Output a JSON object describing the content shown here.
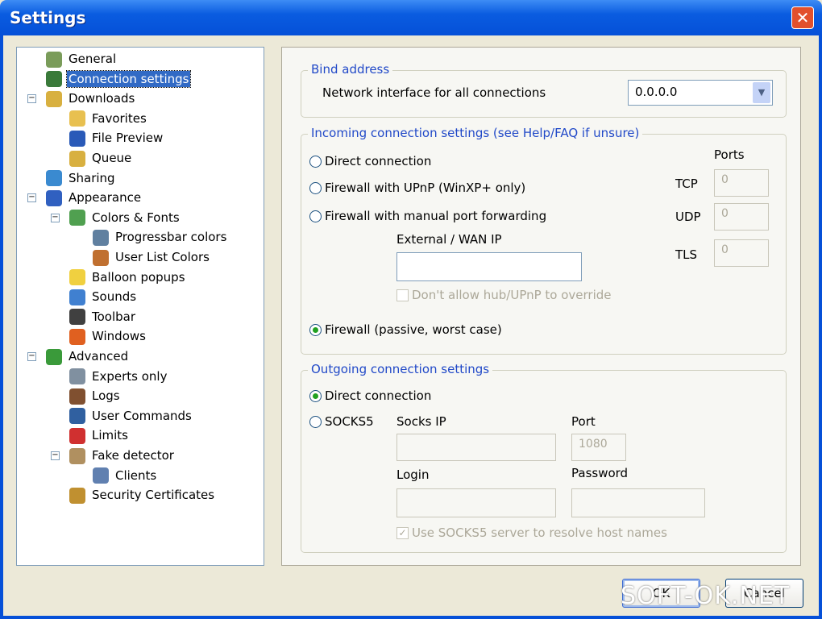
{
  "window": {
    "title": "Settings",
    "close_label": "✕"
  },
  "tree": [
    {
      "label": "General",
      "level": 0,
      "color": "#7a9c5a"
    },
    {
      "label": "Connection settings",
      "level": 0,
      "color": "#3a7a3a",
      "selected": true
    },
    {
      "label": "Downloads",
      "level": 0,
      "color": "#d8b040",
      "expander": "−"
    },
    {
      "label": "Favorites",
      "level": 1,
      "color": "#e8c050"
    },
    {
      "label": "File Preview",
      "level": 1,
      "color": "#2a5ab8"
    },
    {
      "label": "Queue",
      "level": 1,
      "color": "#d8b040"
    },
    {
      "label": "Sharing",
      "level": 0,
      "color": "#3a8ad0"
    },
    {
      "label": "Appearance",
      "level": 0,
      "color": "#3060c0",
      "expander": "−"
    },
    {
      "label": "Colors & Fonts",
      "level": 1,
      "color": "#50a050",
      "expander": "−"
    },
    {
      "label": "Progressbar colors",
      "level": 2,
      "color": "#6080a0"
    },
    {
      "label": "User List Colors",
      "level": 2,
      "color": "#c07030"
    },
    {
      "label": "Balloon popups",
      "level": 1,
      "color": "#f0d040"
    },
    {
      "label": "Sounds",
      "level": 1,
      "color": "#4080d0"
    },
    {
      "label": "Toolbar",
      "level": 1,
      "color": "#404040"
    },
    {
      "label": "Windows",
      "level": 1,
      "color": "#e06020"
    },
    {
      "label": "Advanced",
      "level": 0,
      "color": "#3a9a3a",
      "expander": "−"
    },
    {
      "label": "Experts only",
      "level": 1,
      "color": "#8090a0"
    },
    {
      "label": "Logs",
      "level": 1,
      "color": "#805030"
    },
    {
      "label": "User Commands",
      "level": 1,
      "color": "#3060a0"
    },
    {
      "label": "Limits",
      "level": 1,
      "color": "#d03030"
    },
    {
      "label": "Fake detector",
      "level": 1,
      "color": "#b09060",
      "expander": "−"
    },
    {
      "label": "Clients",
      "level": 2,
      "color": "#6080b0"
    },
    {
      "label": "Security Certificates",
      "level": 1,
      "color": "#c09030"
    }
  ],
  "bind": {
    "legend": "Bind address",
    "label": "Network interface for all connections",
    "value": "0.0.0.0"
  },
  "incoming": {
    "legend": "Incoming connection settings (see Help/FAQ if unsure)",
    "options": [
      "Direct connection",
      "Firewall with UPnP (WinXP+ only)",
      "Firewall with manual port forwarding",
      "Firewall (passive, worst case)"
    ],
    "selected": 3,
    "ports_label": "Ports",
    "tcp_label": "TCP",
    "tcp": "0",
    "udp_label": "UDP",
    "udp": "0",
    "tls_label": "TLS",
    "tls": "0",
    "wan_label": "External / WAN IP",
    "wan_value": "",
    "override_label": "Don't allow hub/UPnP to override"
  },
  "outgoing": {
    "legend": "Outgoing connection settings",
    "direct_label": "Direct connection",
    "socks_label": "SOCKS5",
    "socks_ip_label": "Socks IP",
    "port_label": "Port",
    "port_value": "1080",
    "login_label": "Login",
    "password_label": "Password",
    "resolve_label": "Use SOCKS5 server to resolve host names",
    "resolve_checked": true
  },
  "buttons": {
    "ok": "OK",
    "cancel": "Cancel"
  },
  "watermark": "SOFT-OK.NET"
}
